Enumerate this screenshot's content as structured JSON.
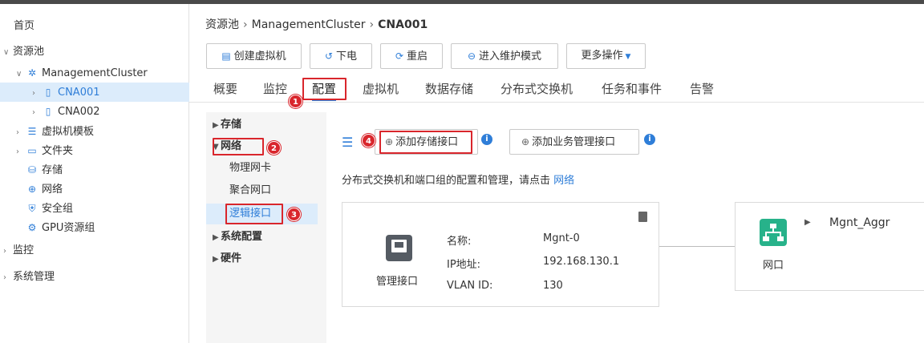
{
  "tree": {
    "items": [
      {
        "label": "首页"
      },
      {
        "label": "资源池"
      },
      {
        "label": "ManagementCluster"
      },
      {
        "label": "CNA001"
      },
      {
        "label": "CNA002"
      },
      {
        "label": "虚拟机模板"
      },
      {
        "label": "文件夹"
      },
      {
        "label": "存储"
      },
      {
        "label": "网络"
      },
      {
        "label": "安全组"
      },
      {
        "label": "GPU资源组"
      },
      {
        "label": "监控"
      },
      {
        "label": "系统管理"
      }
    ]
  },
  "breadcrumb": {
    "root": "资源池",
    "cluster": "ManagementCluster",
    "current": "CNA001",
    "separator": "›"
  },
  "toolbar": {
    "create_vm": "创建虚拟机",
    "power_off": "下电",
    "restart": "重启",
    "maintenance": "进入维护模式",
    "more": "更多操作"
  },
  "tabs": [
    "概要",
    "监控",
    "配置",
    "虚拟机",
    "数据存储",
    "分布式交换机",
    "任务和事件",
    "告警"
  ],
  "config_menu": {
    "storage": "存储",
    "network": "网络",
    "physical_nic": "物理网卡",
    "aggregate_port": "聚合网口",
    "logical_interface": "逻辑接口",
    "system_config": "系统配置",
    "hardware": "硬件"
  },
  "content": {
    "add_storage_interface": "添加存储接口",
    "add_mgmt_interface": "添加业务管理接口",
    "description": "分布式交换机和端口组的配置和管理，请点击",
    "description_link": "网络",
    "card": {
      "icon_label": "管理接口",
      "name_label": "名称:",
      "name_value": "Mgnt-0",
      "ip_label": "IP地址:",
      "ip_value": "192.168.130.1",
      "vlan_label": "VLAN ID:",
      "vlan_value": "130"
    },
    "card2": {
      "icon_label": "网口",
      "name": "Mgnt_Aggr"
    }
  },
  "annotations": [
    "1",
    "2",
    "3",
    "4"
  ],
  "colors": {
    "accent": "#2f7ed8",
    "annotation_red": "#d9262c",
    "selected_bg": "#dcecfb",
    "net_icon": "#27b28a"
  }
}
